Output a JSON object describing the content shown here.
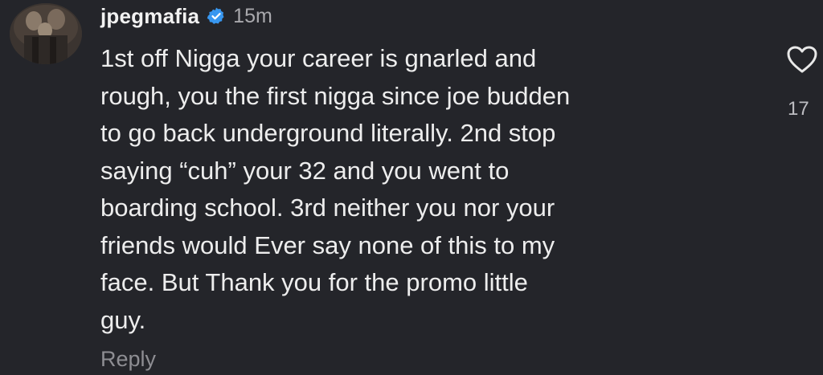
{
  "comment": {
    "username": "jpegmafia",
    "timestamp": "15m",
    "text": "1st off Nigga your career is gnarled and\nrough, you the first nigga since joe budden\nto go back underground literally. 2nd stop\nsaying “cuh” your 32 and you went to\nboarding school. 3rd neither you nor your\nfriends would Ever say none of this to my\nface. But Thank you for the promo little\nguy.",
    "reply_label": "Reply",
    "like_count": "17",
    "verified_icon": "verified-badge-icon",
    "like_icon": "heart-outline-icon"
  },
  "colors": {
    "background": "#24252a",
    "text": "#ededed",
    "muted": "#8e8e93",
    "verified": "#3897f0"
  }
}
